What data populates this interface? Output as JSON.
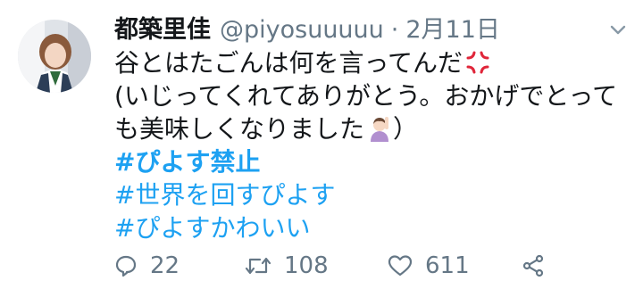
{
  "tweet": {
    "author_name": "都築里佳",
    "handle": "@piyosuuuuu",
    "separator": "·",
    "date": "2月11日",
    "lines": [
      "谷とはたごんは何を言ってんだ",
      "(いじってくれてありがとう。おかげでとって",
      "も美味しくなりました",
      "）"
    ],
    "hashtags": [
      "#ぴよす禁止",
      "#世界を回すぴよす",
      "#ぴよすかわいい"
    ],
    "emoji": [
      "anger-symbol",
      "person-raising-hand"
    ]
  },
  "actions": {
    "reply_count": "22",
    "retweet_count": "108",
    "like_count": "611"
  },
  "icons": {
    "reply": "reply-icon",
    "retweet": "retweet-icon",
    "like": "heart-icon",
    "share": "share-icon",
    "menu": "chevron-down-icon"
  },
  "colors": {
    "hashtag": "#1da1f2",
    "muted": "#657786",
    "text": "#14171a",
    "anger": "#e0263a"
  }
}
